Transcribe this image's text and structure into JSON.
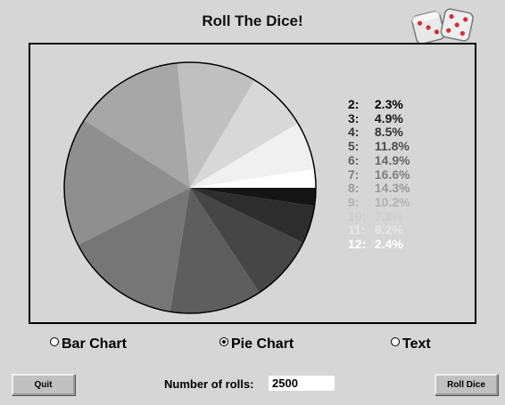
{
  "window": {
    "title": "Roll The Dice!"
  },
  "icons": {
    "dice": "dice-icon"
  },
  "chart_data": {
    "type": "pie",
    "categories": [
      "2",
      "3",
      "4",
      "5",
      "6",
      "7",
      "8",
      "9",
      "10",
      "11",
      "12"
    ],
    "values": [
      2.3,
      4.9,
      8.5,
      11.8,
      14.9,
      16.6,
      14.3,
      10.2,
      7.8,
      6.2,
      2.4
    ],
    "value_labels": [
      "2.3%",
      "4.9%",
      "8.5%",
      "11.8%",
      "14.9%",
      "16.6%",
      "14.3%",
      "10.2%",
      "7.8%",
      "6.2%",
      "2.4%"
    ],
    "colors": [
      "#151515",
      "#2d2d2d",
      "#464646",
      "#5e5e5e",
      "#767676",
      "#8f8f8f",
      "#a7a7a7",
      "#c0c0c0",
      "#d8d8d8",
      "#f0f0f0",
      "#ffffff"
    ],
    "legend_colors": [
      "#000000",
      "#1a1a1a",
      "#333333",
      "#4d4d4d",
      "#666666",
      "#808080",
      "#999999",
      "#b3b3b3",
      "#cccccc",
      "#e6e6e6",
      "#ffffff"
    ],
    "start_angle": "3 o'clock",
    "direction": "clockwise",
    "legend_position": "right"
  },
  "chart_options": {
    "bar_label": "Bar Chart",
    "pie_label": "Pie Chart",
    "text_label": "Text",
    "selected": "pie"
  },
  "controls": {
    "quit_label": "Quit",
    "roll_label": "Roll Dice",
    "rolls_label": "Number of rolls:",
    "rolls_value": "2500"
  }
}
